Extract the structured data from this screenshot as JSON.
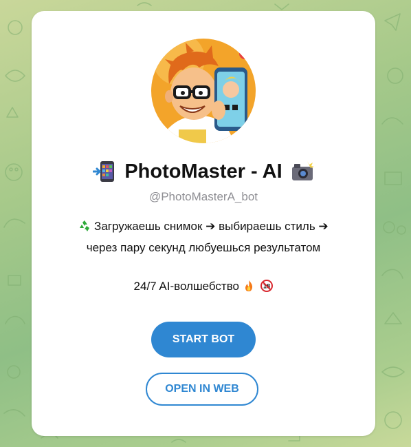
{
  "background": {
    "colors": [
      "#c9d79a",
      "#8fbf86",
      "#aacd8e"
    ]
  },
  "bot": {
    "avatar_icon": "cartoon-guy-selfie-avatar",
    "title_prefix_icon": "mobile-phone-arrow-icon",
    "name": "PhotoMaster - AI",
    "title_suffix_icon": "camera-flash-icon",
    "username": "@PhotoMasterA_bot"
  },
  "description": {
    "line1_icon": "recycle-icon",
    "line1": "Загружаешь снимок ➔ выбираешь стиль ➔",
    "line2": "через пару секунд любуешься результатом",
    "tagline": "24/7 AI-волшебство",
    "tagline_icons": [
      "fire-icon",
      "no-under-18-icon"
    ]
  },
  "buttons": {
    "start": "START BOT",
    "web": "OPEN IN WEB"
  },
  "colors": {
    "accent": "#2f87d2",
    "card": "#ffffff",
    "muted_text": "#8e8e93"
  }
}
